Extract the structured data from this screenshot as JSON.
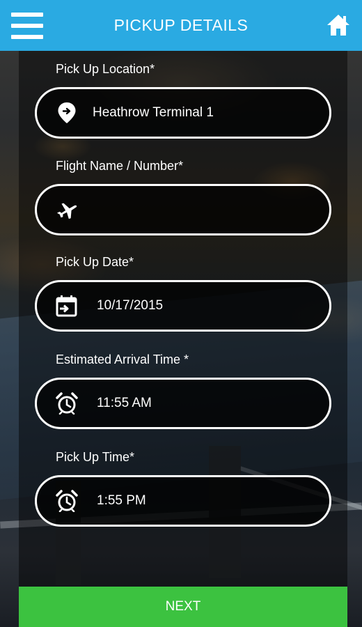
{
  "header": {
    "title": "PICKUP DETAILS",
    "menu_icon": "hamburger-menu-icon",
    "home_icon": "home-icon",
    "color": "#2aaae2"
  },
  "form": {
    "pickup_location": {
      "label": "Pick Up Location*",
      "value": "Heathrow Terminal 1",
      "icon": "location-pin-icon"
    },
    "flight": {
      "label": "Flight Name / Number*",
      "value": "",
      "icon": "airplane-icon"
    },
    "pickup_date": {
      "label": "Pick Up Date*",
      "value": "10/17/2015",
      "icon": "calendar-icon"
    },
    "arrival_time": {
      "label": "Estimated Arrival Time *",
      "value": "11:55 AM",
      "icon": "alarm-clock-icon"
    },
    "pickup_time": {
      "label": "Pick Up Time*",
      "value": "1:55 PM",
      "icon": "alarm-clock-icon"
    }
  },
  "footer": {
    "next_label": "NEXT",
    "color": "#3cc240"
  }
}
